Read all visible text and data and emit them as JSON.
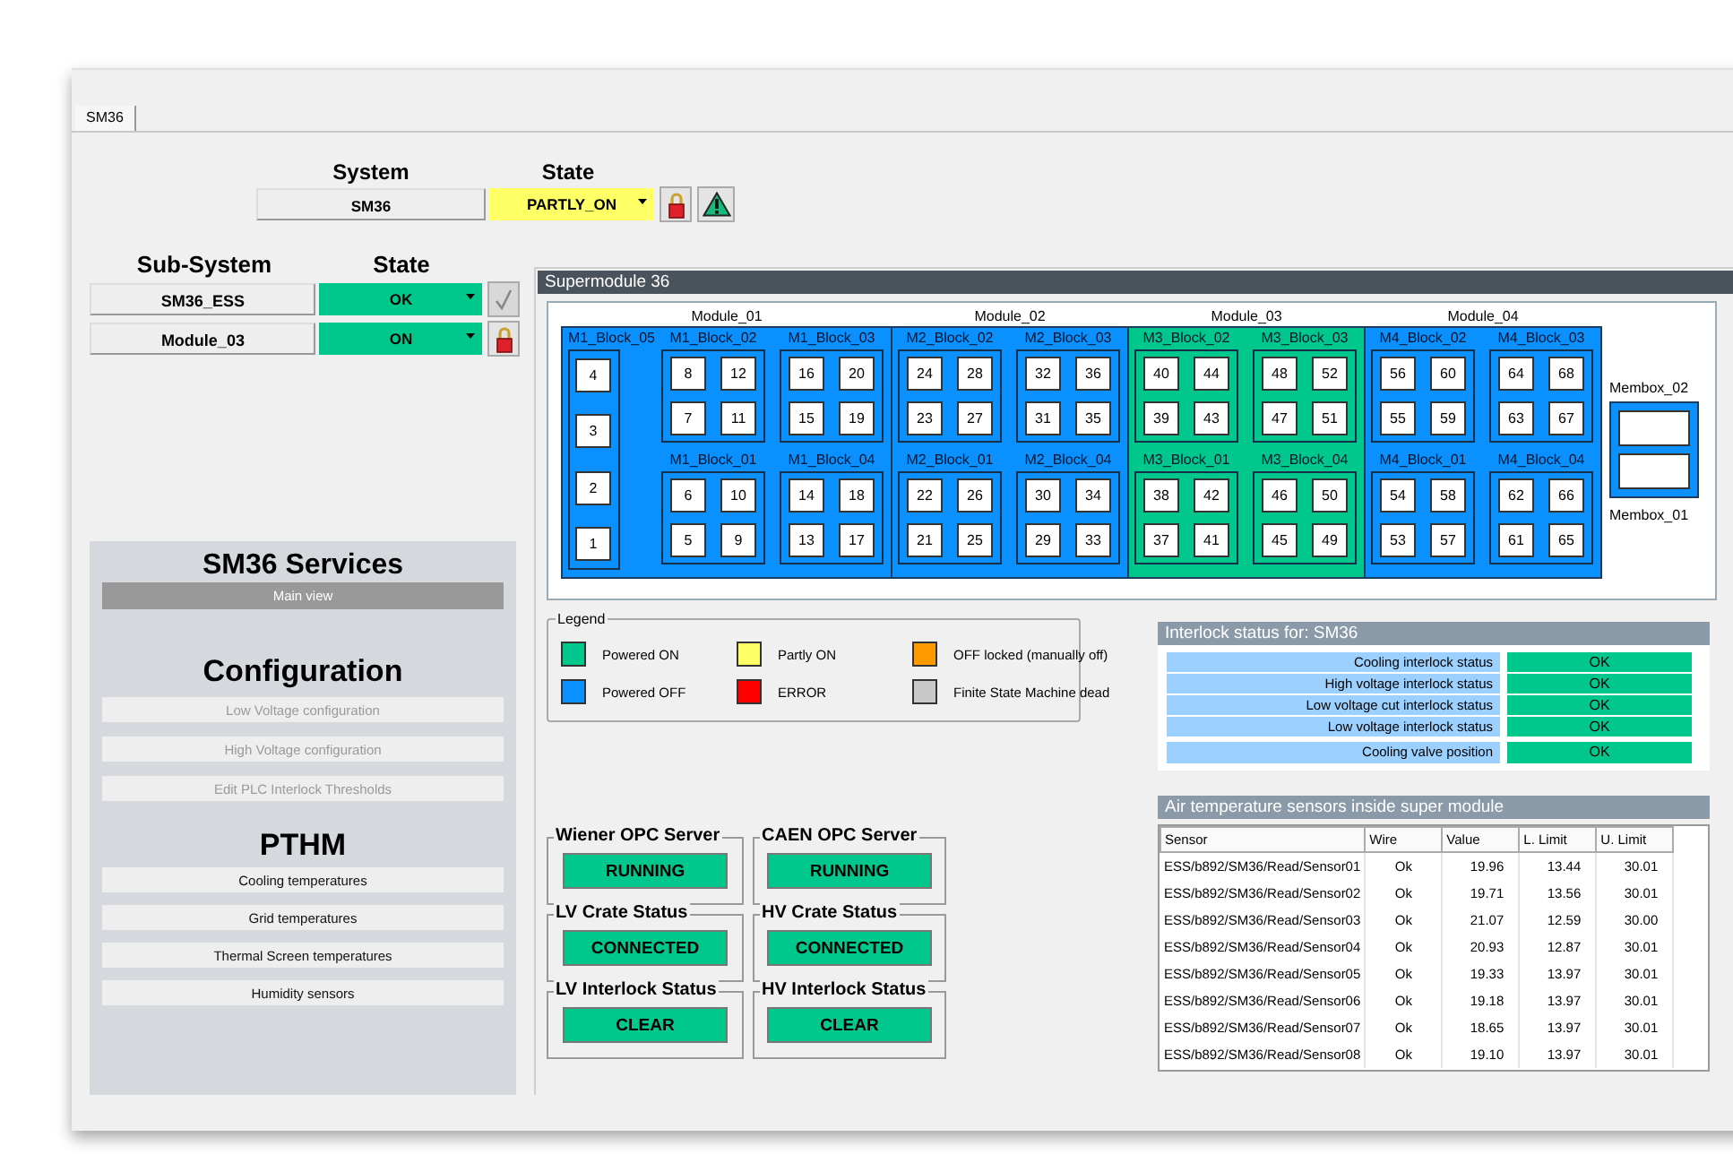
{
  "tabs": [
    {
      "label": "SM36",
      "selected": true
    }
  ],
  "system": {
    "headers": [
      "System",
      "State"
    ],
    "name": "SM36",
    "state": "PARTLY_ON",
    "color": "#ffff66"
  },
  "subsystems": {
    "headers": [
      "Sub-System",
      "State"
    ],
    "rows": [
      {
        "name": "SM36_ESS",
        "state": "OK",
        "color": "#00c88c",
        "kind": "check"
      },
      {
        "name": "Module_03",
        "state": "ON",
        "color": "#00c88c",
        "kind": "lock"
      }
    ]
  },
  "services": {
    "title": "SM36 Services",
    "main_view": {
      "label": "Main view",
      "selected": true
    },
    "sections": [
      {
        "heading": "Configuration",
        "buttons": [
          {
            "label": "Low Voltage configuration",
            "disabled": true
          },
          {
            "label": "High Voltage configuration",
            "disabled": true
          },
          {
            "label": "Edit PLC Interlock Thresholds",
            "disabled": true
          }
        ]
      },
      {
        "heading": "PTHM",
        "buttons": [
          {
            "label": "Cooling temperatures",
            "disabled": false
          },
          {
            "label": "Grid temperatures",
            "disabled": false
          },
          {
            "label": "Thermal Screen temperatures",
            "disabled": false
          },
          {
            "label": "Humidity sensors",
            "disabled": false
          }
        ]
      }
    ]
  },
  "supermodule": {
    "title": "Supermodule 36",
    "modules": [
      {
        "label": "Module_01",
        "color": "#0a90ff",
        "blocks": [
          {
            "label": "M1_Block_05",
            "kind": "column",
            "chips": [
              "4",
              "3",
              "2",
              "1"
            ]
          },
          {
            "label": "M1_Block_02",
            "kind": "square",
            "chips": [
              "8",
              "12",
              "7",
              "11"
            ]
          },
          {
            "label": "M1_Block_03",
            "kind": "square",
            "chips": [
              "16",
              "20",
              "15",
              "19"
            ]
          },
          {
            "label": "M1_Block_01",
            "kind": "square",
            "chips": [
              "6",
              "10",
              "5",
              "9"
            ]
          },
          {
            "label": "M1_Block_04",
            "kind": "square",
            "chips": [
              "14",
              "18",
              "13",
              "17"
            ]
          }
        ]
      },
      {
        "label": "Module_02",
        "color": "#0a90ff",
        "blocks": [
          {
            "label": "M2_Block_02",
            "kind": "square",
            "chips": [
              "24",
              "28",
              "23",
              "27"
            ]
          },
          {
            "label": "M2_Block_03",
            "kind": "square",
            "chips": [
              "32",
              "36",
              "31",
              "35"
            ]
          },
          {
            "label": "M2_Block_01",
            "kind": "square",
            "chips": [
              "22",
              "26",
              "21",
              "25"
            ]
          },
          {
            "label": "M2_Block_04",
            "kind": "square",
            "chips": [
              "30",
              "34",
              "29",
              "33"
            ]
          }
        ]
      },
      {
        "label": "Module_03",
        "color": "#00c88c",
        "blocks": [
          {
            "label": "M3_Block_02",
            "kind": "square",
            "chips": [
              "40",
              "44",
              "39",
              "43"
            ]
          },
          {
            "label": "M3_Block_03",
            "kind": "square",
            "chips": [
              "48",
              "52",
              "47",
              "51"
            ]
          },
          {
            "label": "M3_Block_01",
            "kind": "square",
            "chips": [
              "38",
              "42",
              "37",
              "41"
            ]
          },
          {
            "label": "M3_Block_04",
            "kind": "square",
            "chips": [
              "46",
              "50",
              "45",
              "49"
            ]
          }
        ]
      },
      {
        "label": "Module_04",
        "color": "#0a90ff",
        "blocks": [
          {
            "label": "M4_Block_02",
            "kind": "square",
            "chips": [
              "56",
              "60",
              "55",
              "59"
            ]
          },
          {
            "label": "M4_Block_03",
            "kind": "square",
            "chips": [
              "64",
              "68",
              "63",
              "67"
            ]
          },
          {
            "label": "M4_Block_01",
            "kind": "square",
            "chips": [
              "54",
              "58",
              "53",
              "57"
            ]
          },
          {
            "label": "M4_Block_04",
            "kind": "square",
            "chips": [
              "62",
              "66",
              "61",
              "65"
            ]
          }
        ]
      }
    ],
    "membox": {
      "top_label": "Membox_02",
      "bottom_label": "Membox_01",
      "color": "#0a90ff"
    }
  },
  "legend": {
    "title": "Legend",
    "items": [
      {
        "label": "Powered ON",
        "color": "#00c88c"
      },
      {
        "label": "Partly ON",
        "color": "#ffff66"
      },
      {
        "label": "OFF locked (manually off)",
        "color": "#ff9900"
      },
      {
        "label": "Powered OFF",
        "color": "#0a90ff"
      },
      {
        "label": "ERROR",
        "color": "#ff0000"
      },
      {
        "label": "Finite State Machine dead",
        "color": "#c8c8c8"
      }
    ]
  },
  "status_groups": [
    {
      "title": "Wiener OPC Server",
      "value": "RUNNING",
      "color": "#00c88c"
    },
    {
      "title": "CAEN OPC Server",
      "value": "RUNNING",
      "color": "#00c88c"
    },
    {
      "title": "LV Crate Status",
      "value": "CONNECTED",
      "color": "#00c88c"
    },
    {
      "title": "HV Crate Status",
      "value": "CONNECTED",
      "color": "#00c88c"
    },
    {
      "title": "LV Interlock Status",
      "value": "CLEAR",
      "color": "#00c88c"
    },
    {
      "title": "HV Interlock Status",
      "value": "CLEAR",
      "color": "#00c88c"
    }
  ],
  "interlock": {
    "title": "Interlock status for: SM36",
    "rows": [
      {
        "label": "Cooling interlock status",
        "value": "OK",
        "color": "#00c88c"
      },
      {
        "label": "High voltage interlock status",
        "value": "OK",
        "color": "#00c88c"
      },
      {
        "label": "Low voltage cut interlock status",
        "value": "OK",
        "color": "#00c88c"
      },
      {
        "label": "Low voltage interlock status",
        "value": "OK",
        "color": "#00c88c"
      },
      {
        "label": "Cooling valve position",
        "value": "OK",
        "color": "#00c88c"
      }
    ]
  },
  "air_sensors": {
    "title": "Air temperature sensors inside super module",
    "columns": [
      "Sensor",
      "Wire",
      "Value",
      "L. Limit",
      "U. Limit"
    ],
    "rows": [
      [
        "ESS/b892/SM36/Read/Sensor01",
        "Ok",
        "19.96",
        "13.44",
        "30.01"
      ],
      [
        "ESS/b892/SM36/Read/Sensor02",
        "Ok",
        "19.71",
        "13.56",
        "30.01"
      ],
      [
        "ESS/b892/SM36/Read/Sensor03",
        "Ok",
        "21.07",
        "12.59",
        "30.00"
      ],
      [
        "ESS/b892/SM36/Read/Sensor04",
        "Ok",
        "20.93",
        "12.87",
        "30.01"
      ],
      [
        "ESS/b892/SM36/Read/Sensor05",
        "Ok",
        "19.33",
        "13.97",
        "30.01"
      ],
      [
        "ESS/b892/SM36/Read/Sensor06",
        "Ok",
        "19.18",
        "13.97",
        "30.01"
      ],
      [
        "ESS/b892/SM36/Read/Sensor07",
        "Ok",
        "18.65",
        "13.97",
        "30.01"
      ],
      [
        "ESS/b892/SM36/Read/Sensor08",
        "Ok",
        "19.10",
        "13.97",
        "30.01"
      ]
    ]
  }
}
